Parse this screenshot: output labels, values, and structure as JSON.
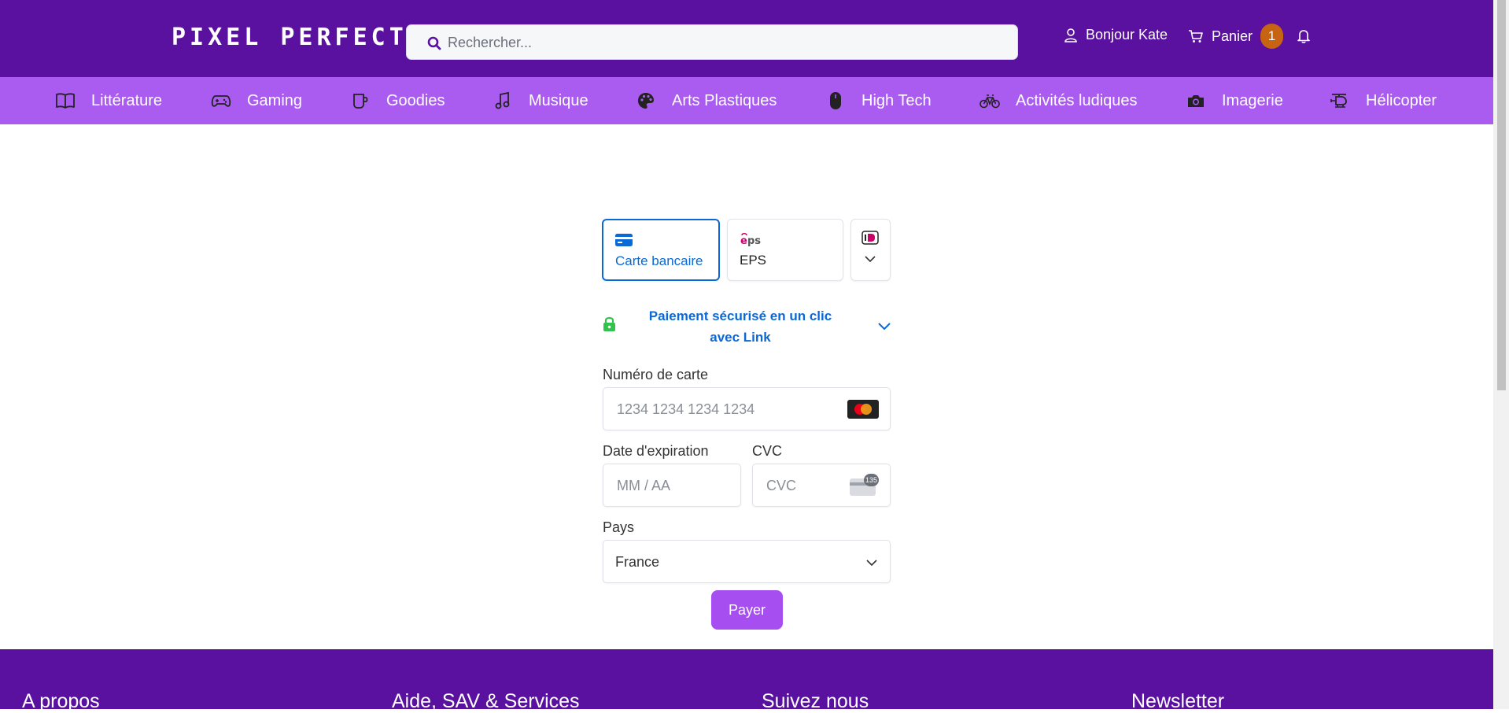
{
  "header": {
    "logo": "PIXEL PERFECT",
    "search_placeholder": "Rechercher...",
    "greeting": "Bonjour Kate",
    "cart_label": "Panier",
    "cart_count": "1",
    "colors": {
      "topbar": "#5b119f",
      "catnav": "#ab5cf0",
      "badge": "#c76414"
    }
  },
  "categories": [
    {
      "label": "Littérature",
      "icon": "book-icon"
    },
    {
      "label": "Gaming",
      "icon": "gamepad-icon"
    },
    {
      "label": "Goodies",
      "icon": "mug-icon"
    },
    {
      "label": "Musique",
      "icon": "music-note-icon"
    },
    {
      "label": "Arts Plastiques",
      "icon": "palette-icon"
    },
    {
      "label": "High Tech",
      "icon": "mouse-icon"
    },
    {
      "label": "Activités ludiques",
      "icon": "bicycle-icon"
    },
    {
      "label": "Imagerie",
      "icon": "camera-icon"
    },
    {
      "label": "Hélicopter",
      "icon": "helicopter-icon"
    }
  ],
  "payment": {
    "tabs": [
      {
        "label": "Carte bancaire",
        "icon": "credit-card-icon",
        "selected": true
      },
      {
        "label": "EPS",
        "icon": "eps-logo-icon",
        "selected": false
      }
    ],
    "link_text": "Paiement sécurisé en un clic avec Link",
    "card_number_label": "Numéro de carte",
    "card_number_placeholder": "1234 1234 1234 1234",
    "expiry_label": "Date d'expiration",
    "expiry_placeholder": "MM / AA",
    "cvc_label": "CVC",
    "cvc_placeholder": "CVC",
    "cvc_icon_text": "135",
    "country_label": "Pays",
    "country_value": "France",
    "pay_button": "Payer",
    "accent_color": "#0a69d6",
    "pay_color": "#a64ef0"
  },
  "footer": {
    "headings": [
      "A propos",
      "Aide, SAV & Services",
      "Suivez nous",
      "Newsletter"
    ]
  }
}
